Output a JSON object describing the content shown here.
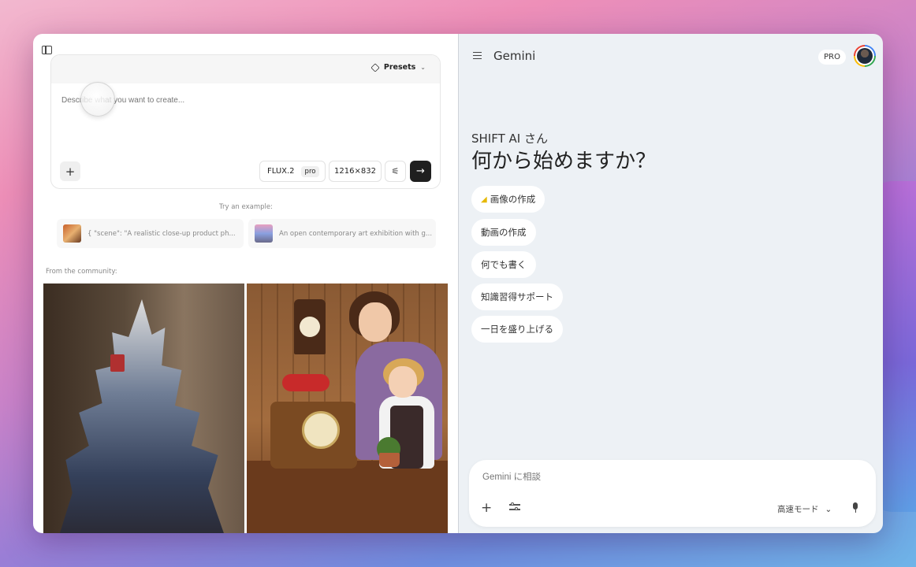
{
  "left_panel": {
    "presets_label": "Presets",
    "prompt_placeholder": "Describe what you want to create...",
    "model_name": "FLUX.2",
    "model_tier": "pro",
    "image_size": "1216×832",
    "try_example_label": "Try an example:",
    "examples": [
      {
        "text": "{ \"scene\": \"A realistic close-up product ph..."
      },
      {
        "text": "An open contemporary art exhibition with g..."
      }
    ],
    "community_label": "From the community:"
  },
  "right_panel": {
    "app_title": "Gemini",
    "plan_badge": "PRO",
    "greeting_name": "SHIFT AI さん",
    "greeting_question": "何から始めますか？",
    "chips": [
      {
        "label": "画像の作成",
        "icon": "banana-icon"
      },
      {
        "label": "動画の作成"
      },
      {
        "label": "何でも書く"
      },
      {
        "label": "知識習得サポート"
      },
      {
        "label": "一日を盛り上げる"
      }
    ],
    "chat_placeholder": "Gemini に相談",
    "mode_label": "高速モード"
  }
}
